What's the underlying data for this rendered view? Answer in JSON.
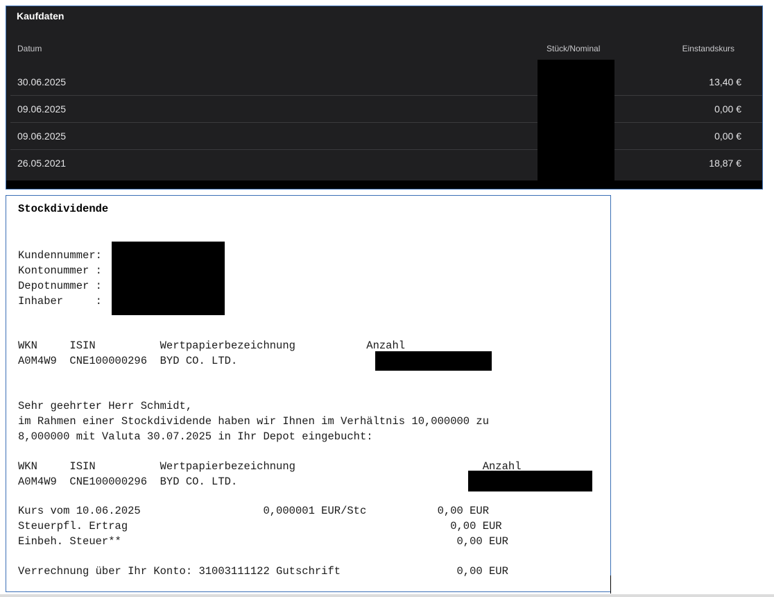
{
  "kaufdaten": {
    "title": "Kaufdaten",
    "columns": {
      "datum": "Datum",
      "stueck": "Stück/Nominal",
      "einstandskurs": "Einstandskurs"
    },
    "rows": [
      {
        "datum": "30.06.2025",
        "einstandskurs": "13,40 €"
      },
      {
        "datum": "09.06.2025",
        "einstandskurs": "0,00 €"
      },
      {
        "datum": "09.06.2025",
        "einstandskurs": "0,00 €"
      },
      {
        "datum": "26.05.2021",
        "einstandskurs": "18,87 €"
      }
    ]
  },
  "document": {
    "title": "Stockdividende",
    "kundennummer": "Kundennummer:",
    "kontonummer": "Kontonummer :",
    "depotnummer": "Depotnummer :",
    "inhaber": "Inhaber     :",
    "table1_header": "WKN     ISIN          Wertpapierbezeichnung           Anzahl",
    "table1_row": "A0M4W9  CNE100000296  BYD CO. LTD.",
    "salutation": "Sehr geehrter Herr Schmidt,",
    "body_line1": "im Rahmen einer Stockdividende haben wir Ihnen im Verhältnis 10,000000 zu",
    "body_line2": "8,000000 mit Valuta 30.07.2025 in Ihr Depot eingebucht:",
    "table2_header": "WKN     ISIN          Wertpapierbezeichnung                             Anzahl",
    "table2_row": "A0M4W9  CNE100000296  BYD CO. LTD.",
    "kurs_line": "Kurs vom 10.06.2025                   0,000001 EUR/Stc           0,00 EUR",
    "steuerpfl_line": "Steuerpfl. Ertrag                                                  0,00 EUR",
    "einbeh_line": "Einbeh. Steuer**                                                    0,00 EUR",
    "verrechnung_line": "Verrechnung über Ihr Konto: 31003111122 Gutschrift                  0,00 EUR"
  }
}
